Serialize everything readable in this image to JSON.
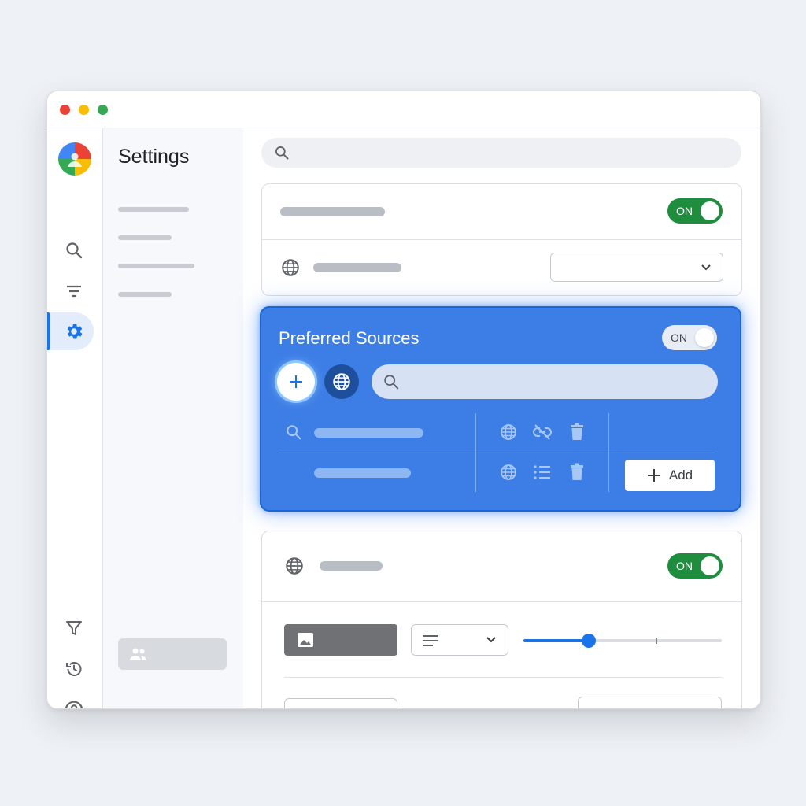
{
  "window": {
    "title": "Settings",
    "dots": [
      "close",
      "minimize",
      "maximize"
    ]
  },
  "rail": {
    "items": [
      {
        "icon": "search-icon"
      },
      {
        "icon": "filter-icon"
      },
      {
        "icon": "gear-icon",
        "active": true
      },
      {
        "icon": "funnel-icon"
      },
      {
        "icon": "history-icon"
      },
      {
        "icon": "help-icon"
      }
    ]
  },
  "nav": {
    "title": "Settings"
  },
  "search": {
    "value": "",
    "placeholder": ""
  },
  "card1": {
    "toggle_label": "ON",
    "toggle_on": true,
    "select_value": ""
  },
  "preferred": {
    "title": "Preferred Sources",
    "toggle_label": "ON",
    "search_value": "",
    "add_label": "Add"
  },
  "card3": {
    "toggle_label": "ON",
    "toggle_on": true,
    "slider_value": 0.33
  },
  "colors": {
    "accent": "#1a73e8",
    "toggle_on": "#1e8e3e",
    "highlight_card": "#3d7ee6"
  }
}
